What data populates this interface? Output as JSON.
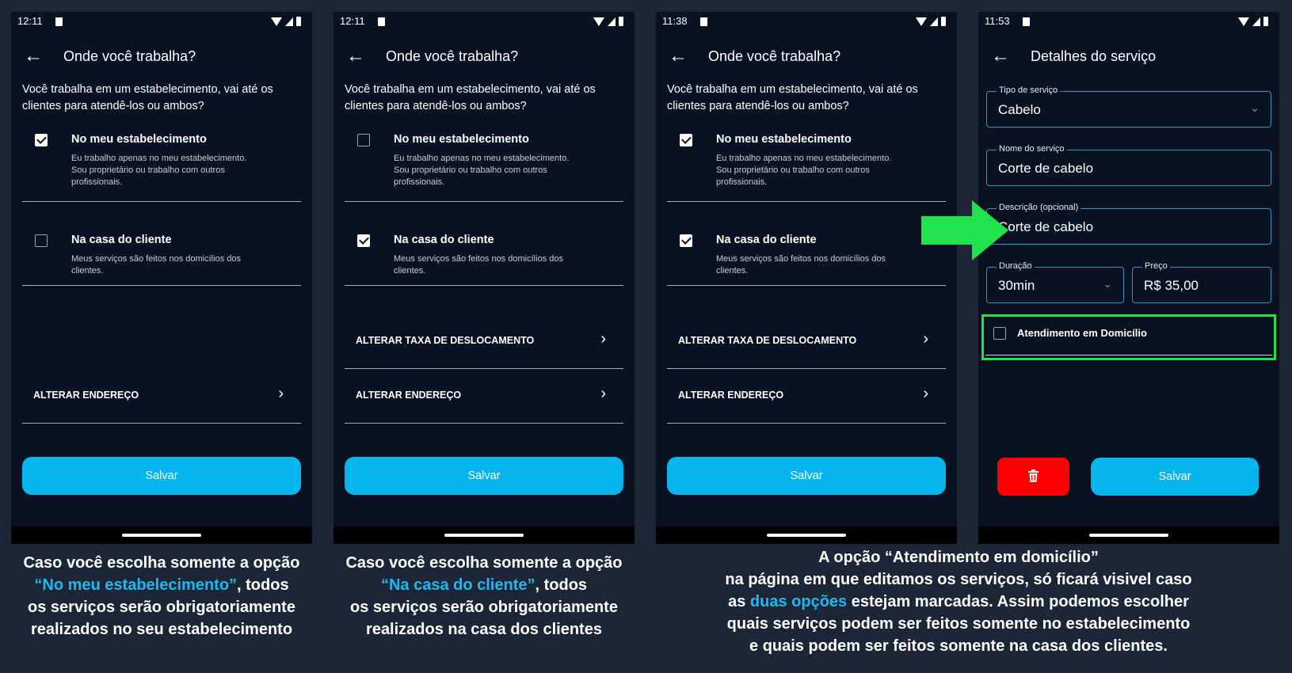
{
  "screens": [
    {
      "time": "12:11",
      "title": "Onde você trabalha?",
      "question": "Você trabalha em um estabelecimento, vai até os clientes para atendê-los ou ambos?",
      "options": [
        {
          "label": "No meu estabelecimento",
          "desc": "Eu trabalho apenas no meu estabelecimento. Sou proprietário ou trabalho com outros profissionais.",
          "checked": true
        },
        {
          "label": "Na casa do cliente",
          "desc": "Meus serviços são feitos nos domicílios dos clientes.",
          "checked": false
        }
      ],
      "links": [
        "ALTERAR ENDEREÇO"
      ],
      "save": "Salvar"
    },
    {
      "time": "12:11",
      "title": "Onde você trabalha?",
      "question": "Você trabalha em um estabelecimento, vai até os clientes para atendê-los ou ambos?",
      "options": [
        {
          "label": "No meu estabelecimento",
          "desc": "Eu trabalho apenas no meu estabelecimento. Sou proprietário ou trabalho com outros profissionais.",
          "checked": false
        },
        {
          "label": "Na casa do cliente",
          "desc": "Meus serviços são feitos nos domicílios dos clientes.",
          "checked": true
        }
      ],
      "links": [
        "ALTERAR TAXA DE DESLOCAMENTO",
        "ALTERAR ENDEREÇO"
      ],
      "save": "Salvar"
    },
    {
      "time": "11:38",
      "title": "Onde você trabalha?",
      "question": "Você trabalha em um estabelecimento, vai até os clientes para atendê-los ou ambos?",
      "options": [
        {
          "label": "No meu estabelecimento",
          "desc": "Eu trabalho apenas no meu estabelecimento. Sou proprietário ou trabalho com outros profissionais.",
          "checked": true
        },
        {
          "label": "Na casa do cliente",
          "desc": "Meus serviços são feitos nos domicílios dos clientes.",
          "checked": true
        }
      ],
      "links": [
        "ALTERAR TAXA DE DESLOCAMENTO",
        "ALTERAR ENDEREÇO"
      ],
      "save": "Salvar"
    }
  ],
  "service": {
    "time": "11:53",
    "title": "Detalhes do serviço",
    "tipo_label": "Tipo de serviço",
    "tipo_value": "Cabelo",
    "nome_label": "Nome do serviço",
    "nome_value": "Corte de cabelo",
    "desc_label": "Descrição (opcional)",
    "desc_value": "Corte de cabelo",
    "duracao_label": "Duração",
    "duracao_value": "30min",
    "preco_label": "Preço",
    "preco_value": "R$ 35,00",
    "domicilio_label": "Atendimento em Domicílio",
    "save": "Salvar"
  },
  "captions": {
    "c1_pre": "Caso você escolha somente a opção",
    "c1_hl": "“No meu estabelecimento”",
    "c1_post": ", todos",
    "c1_l3": "os serviços serão obrigatoriamente",
    "c1_l4": "realizados no seu estabelecimento",
    "c2_pre": "Caso você escolha somente a opção",
    "c2_hl": "“Na casa do cliente”",
    "c2_post": ", todos",
    "c2_l3": "os serviços serão obrigatoriamente",
    "c2_l4": "realizados na casa dos clientes",
    "c3_l1": "A opção “Atendimento em domicílio”",
    "c3_l2": "na página em que editamos os serviços, só ficará visivel caso",
    "c3_pre": "as",
    "c3_hl": "duas opções",
    "c3_post": "estejam marcadas. Assim podemos escolher",
    "c3_l4": "quais serviços podem ser feitos somente no estabelecimento",
    "c3_l5": "e quais podem ser feitos somente na casa dos clientes."
  },
  "colors": {
    "accent": "#05b5ec",
    "highlight": "#1fb8f0",
    "arrow": "#1fe34a",
    "delete": "#ff0000",
    "bg": "#0a1222"
  }
}
